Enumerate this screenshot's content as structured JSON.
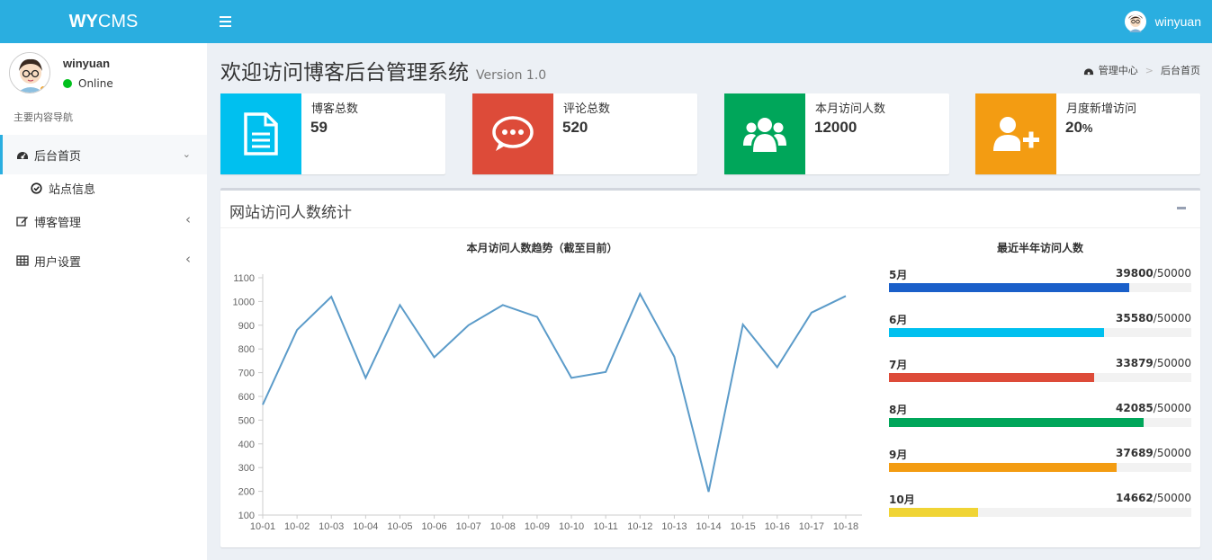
{
  "app": {
    "logo_bold": "WY",
    "logo_rest": "CMS"
  },
  "topbar": {
    "username": "winyuan"
  },
  "sidebar": {
    "username": "winyuan",
    "status": "Online",
    "nav_header": "主要内容导航",
    "items": [
      {
        "label": "后台首页",
        "icon": "dashboard-icon",
        "chevron": "⌄"
      },
      {
        "label": "博客管理",
        "icon": "edit-icon",
        "chevron": "‹"
      },
      {
        "label": "用户设置",
        "icon": "table-icon",
        "chevron": "‹"
      }
    ],
    "sub_items": [
      {
        "label": "站点信息",
        "icon": "check-circle-icon"
      }
    ]
  },
  "page": {
    "title": "欢迎访问博客后台管理系统",
    "version": "Version 1.0",
    "breadcrumb": [
      "管理中心",
      "后台首页"
    ]
  },
  "info_boxes": [
    {
      "label": "博客总数",
      "value": "59",
      "color": "#00c0ef",
      "icon": "document-icon"
    },
    {
      "label": "评论总数",
      "value": "520",
      "color": "#dd4b39",
      "icon": "comment-icon"
    },
    {
      "label": "本月访问人数",
      "value": "12000",
      "color": "#00a65a",
      "icon": "users-icon"
    },
    {
      "label": "月度新增访问",
      "value": "20",
      "unit": "%",
      "color": "#f39c12",
      "icon": "user-plus-icon"
    }
  ],
  "panel": {
    "title": "网站访问人数统计"
  },
  "chart_data": [
    {
      "type": "line",
      "title": "本月访问人数趋势（截至目前）",
      "categories": [
        "10-01",
        "10-02",
        "10-03",
        "10-04",
        "10-05",
        "10-06",
        "10-07",
        "10-08",
        "10-09",
        "10-10",
        "10-11",
        "10-12",
        "10-13",
        "10-14",
        "10-15",
        "10-16",
        "10-17",
        "10-18"
      ],
      "values": [
        565,
        880,
        1020,
        678,
        985,
        765,
        900,
        985,
        935,
        678,
        703,
        1032,
        767,
        198,
        903,
        723,
        953,
        1023
      ],
      "ylim": [
        100,
        1100
      ],
      "yticks": [
        100,
        200,
        300,
        400,
        500,
        600,
        700,
        800,
        900,
        1000,
        1100
      ],
      "line_color": "#5b9bc9",
      "grid": false
    },
    {
      "type": "bar",
      "title": "最近半年访问人数",
      "max": "50000",
      "rows": [
        {
          "month": "5月",
          "value": 39800,
          "value_label": "39800",
          "color": "#1a5fc9"
        },
        {
          "month": "6月",
          "value": 35580,
          "value_label": "35580",
          "color": "#00c0ef"
        },
        {
          "month": "7月",
          "value": 33879,
          "value_label": "33879",
          "color": "#dd4b39"
        },
        {
          "month": "8月",
          "value": 42085,
          "value_label": "42085",
          "color": "#00a65a"
        },
        {
          "month": "9月",
          "value": 37689,
          "value_label": "37689",
          "color": "#f39c12"
        },
        {
          "month": "10月",
          "value": 14662,
          "value_label": "14662",
          "color": "#f0d435"
        }
      ]
    }
  ]
}
